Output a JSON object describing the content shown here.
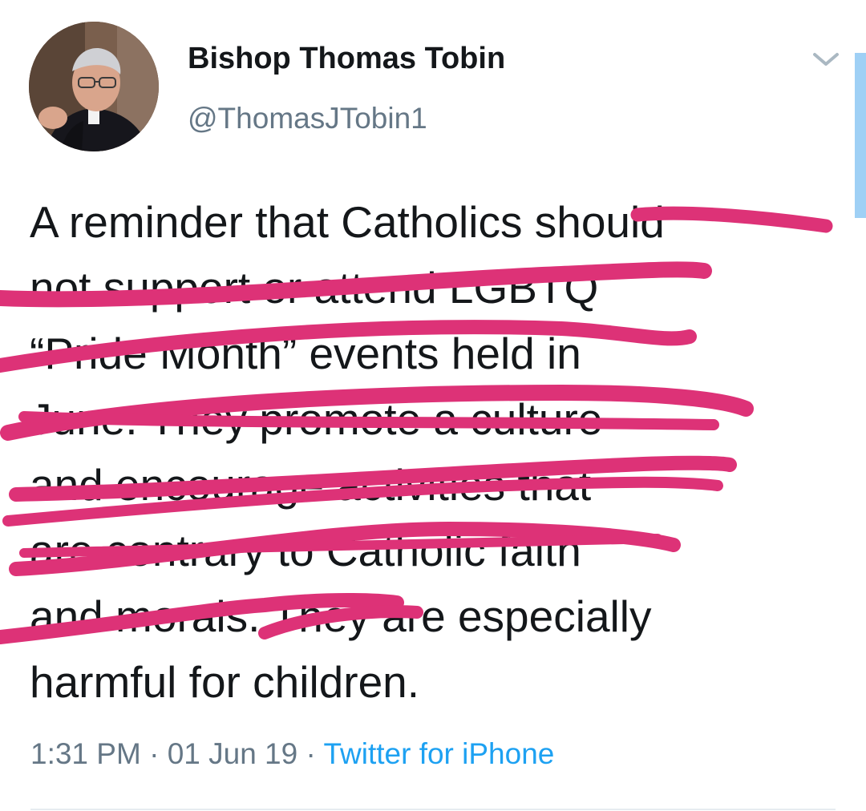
{
  "tweet": {
    "display_name": "Bishop Thomas Tobin",
    "handle": "@ThomasJTobin1",
    "lines": [
      "A reminder that Catholics should",
      "not support or attend LGBTQ",
      "“Pride Month” events held in",
      "June. They promote a culture",
      "and encourage activities that",
      "are contrary to Catholic faith",
      "and morals. They are especially",
      "harmful for children."
    ],
    "time": "1:31 PM",
    "date": "01 Jun 19",
    "separator": "·",
    "source": "Twitter for iPhone"
  },
  "icons": {
    "avatar": "avatar-photo",
    "menu": "chevron-down-icon"
  },
  "colors": {
    "scribble": "#dd3277",
    "text": "#14171a",
    "secondary": "#657786",
    "link": "#1da1f2"
  }
}
